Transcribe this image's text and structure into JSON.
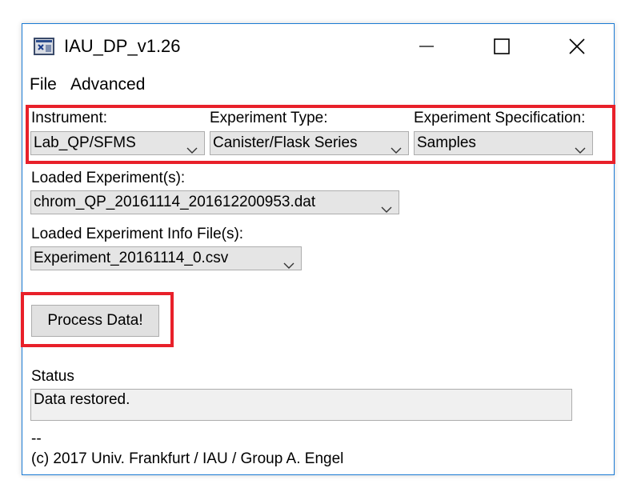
{
  "window": {
    "title": "IAU_DP_v1.26"
  },
  "menu": {
    "file": "File",
    "advanced": "Advanced"
  },
  "selectors": {
    "instrument": {
      "label": "Instrument:",
      "value": "Lab_QP/SFMS"
    },
    "experiment_type": {
      "label": "Experiment Type:",
      "value": "Canister/Flask Series"
    },
    "experiment_spec": {
      "label": "Experiment Specification:",
      "value": "Samples"
    }
  },
  "loaded_experiments": {
    "label": "Loaded Experiment(s):",
    "value": "chrom_QP_20161114_201612200953.dat"
  },
  "loaded_info_files": {
    "label": "Loaded Experiment Info File(s):",
    "value": "Experiment_20161114_0.csv"
  },
  "process_button": "Process Data!",
  "status": {
    "label": "Status",
    "text": "Data restored."
  },
  "footer": {
    "dash": "--",
    "copyright": "(c) 2017 Univ. Frankfurt / IAU / Group A. Engel"
  },
  "colors": {
    "highlight": "#e8202a",
    "window_border": "#1a7ad4"
  }
}
